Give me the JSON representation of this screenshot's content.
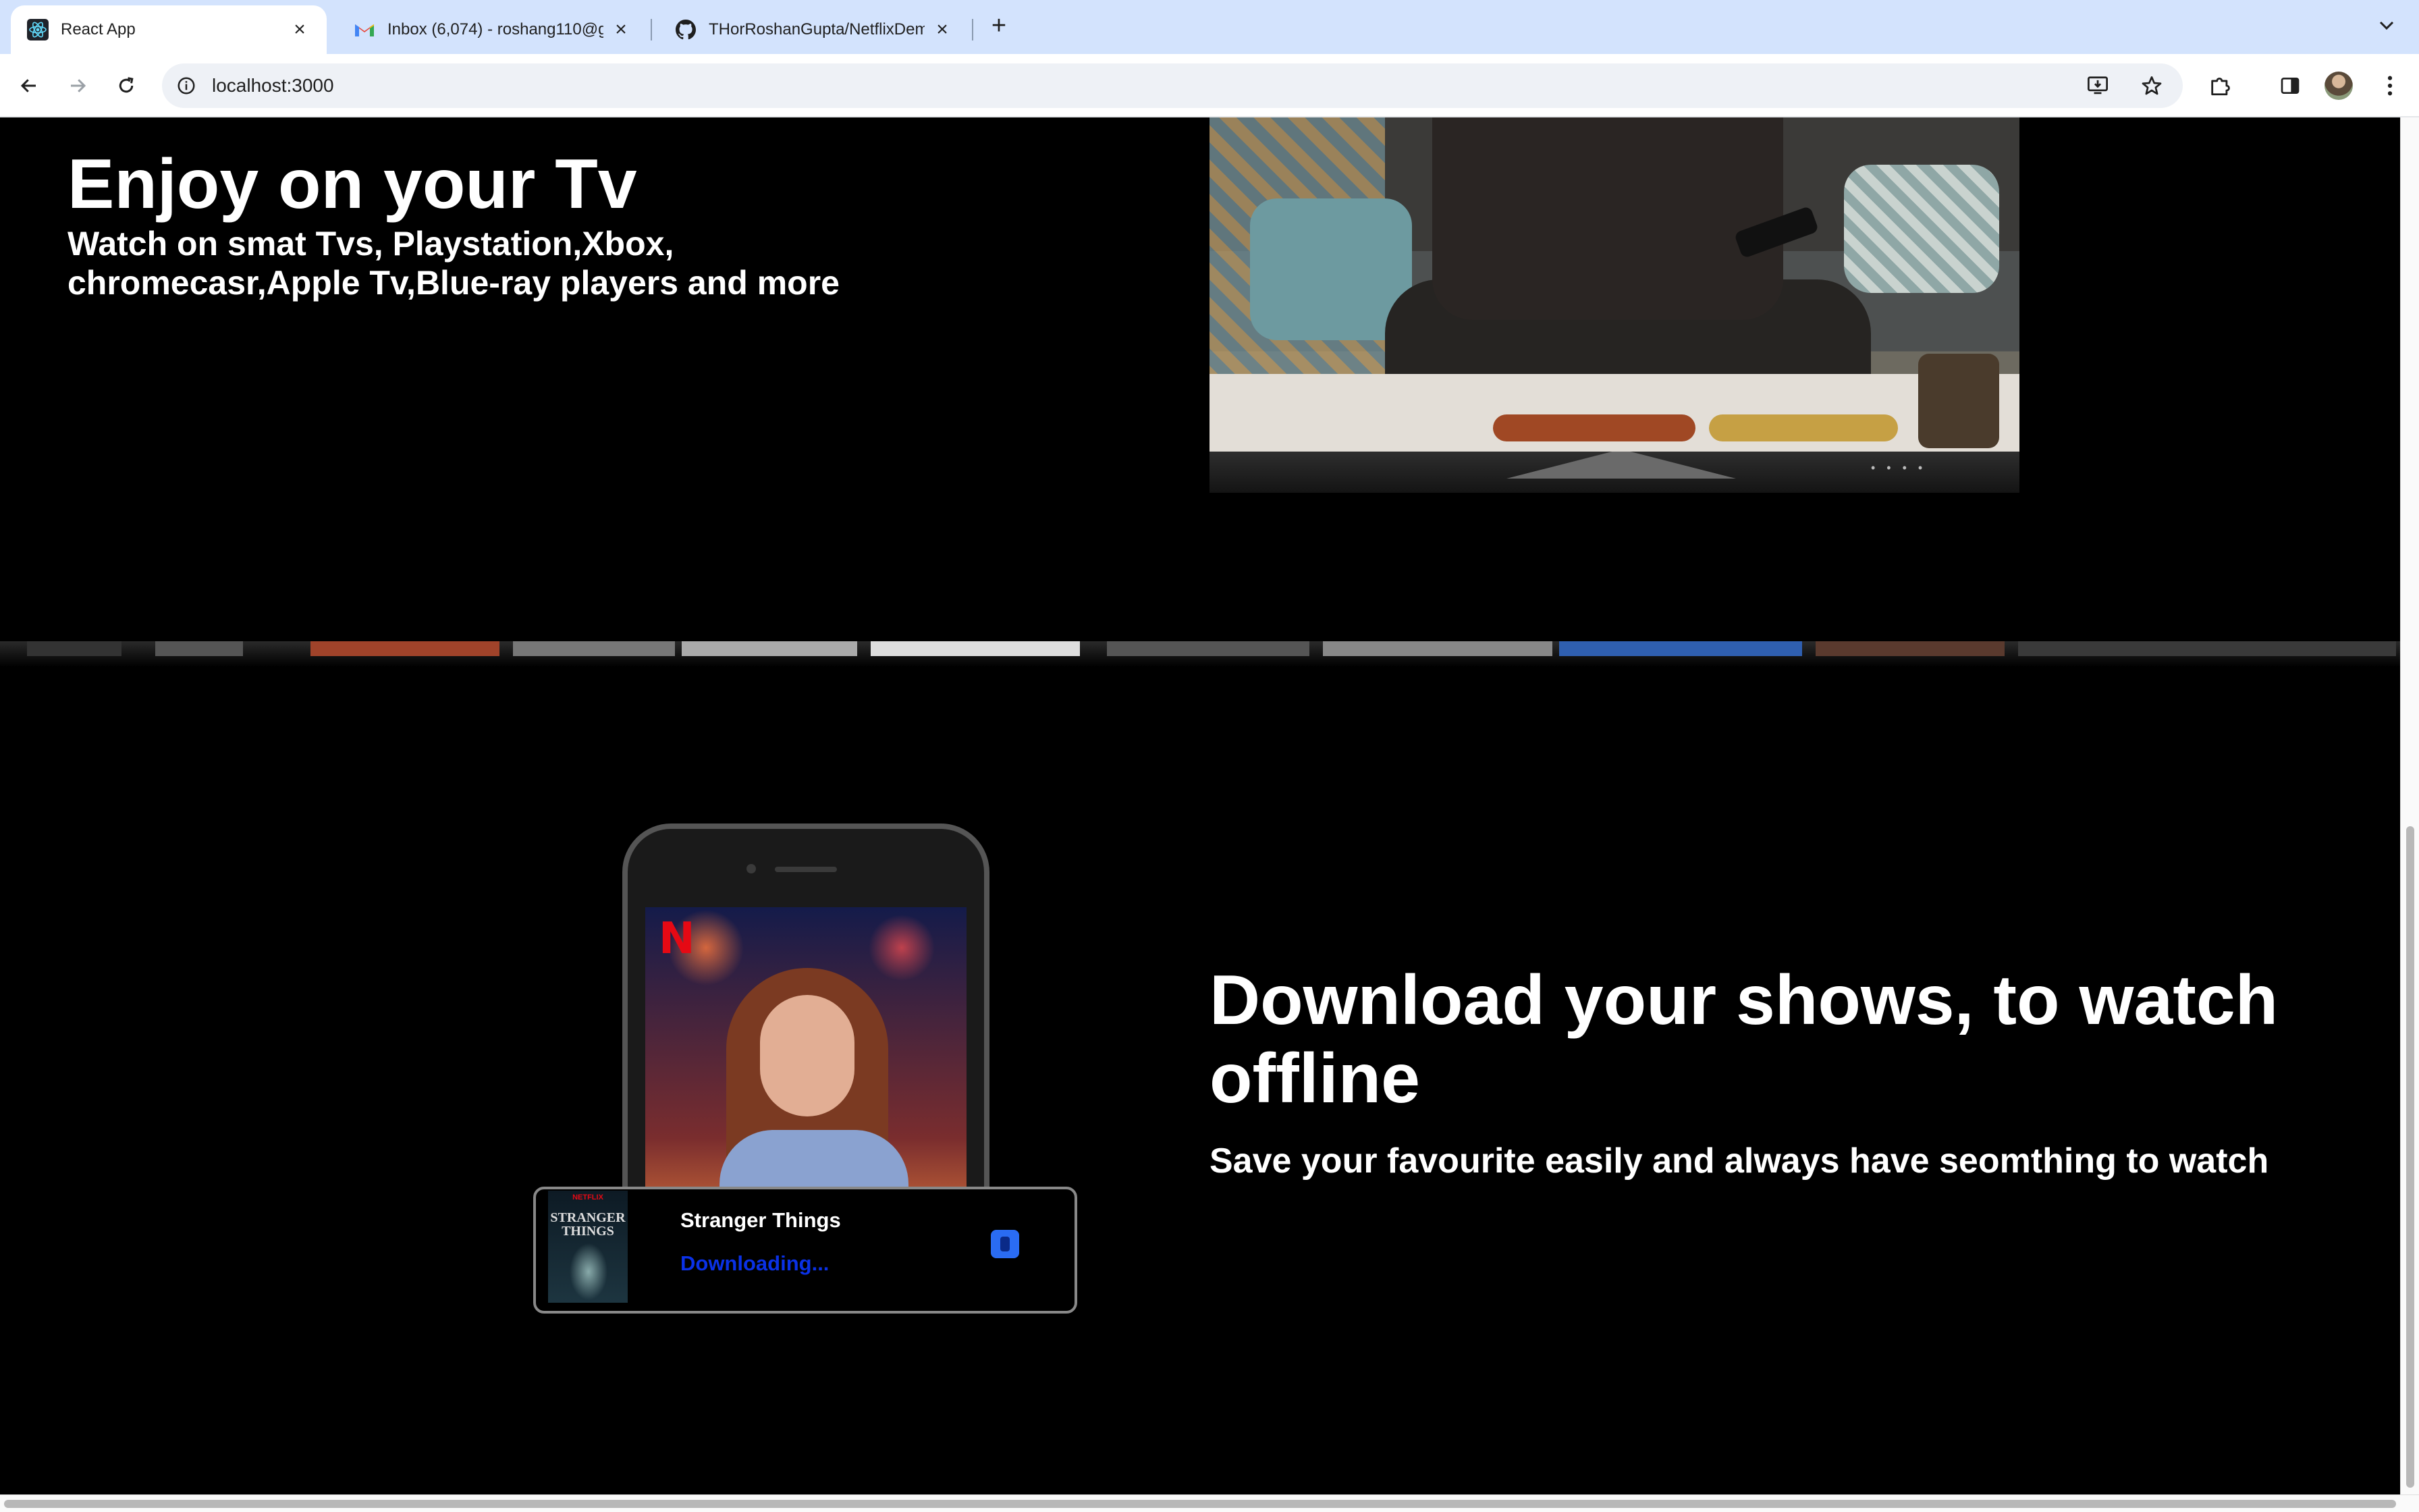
{
  "browser": {
    "tabs": [
      {
        "title": "React App",
        "icon": "react-icon",
        "active": true
      },
      {
        "title": "Inbox (6,074) - roshang110@g",
        "icon": "gmail-icon",
        "active": false
      },
      {
        "title": "THorRoshanGupta/NetflixDem",
        "icon": "github-icon",
        "active": false
      }
    ],
    "new_tab_label": "+",
    "url": "localhost:3000"
  },
  "tv_section": {
    "heading": "Enjoy on your Tv",
    "subheading": "Watch on smat Tvs, Playstation,Xbox, chromecasr,Apple Tv,Blue-ray players and more"
  },
  "download_section": {
    "heading": "Download your shows, to watch offline",
    "subheading": "Save your favourite easily and always have seomthing to watch",
    "card": {
      "title": "Stranger Things",
      "status": "Downloading...",
      "thumb_brand": "NETFLIX",
      "thumb_title": "STRANGER THINGS"
    },
    "phone_logo": "N"
  },
  "colors": {
    "page_bg": "#000000",
    "text": "#ffffff",
    "downloading_blue": "#0a31e6",
    "netflix_red": "#e50914",
    "tabstrip": "#d3e3fd"
  }
}
